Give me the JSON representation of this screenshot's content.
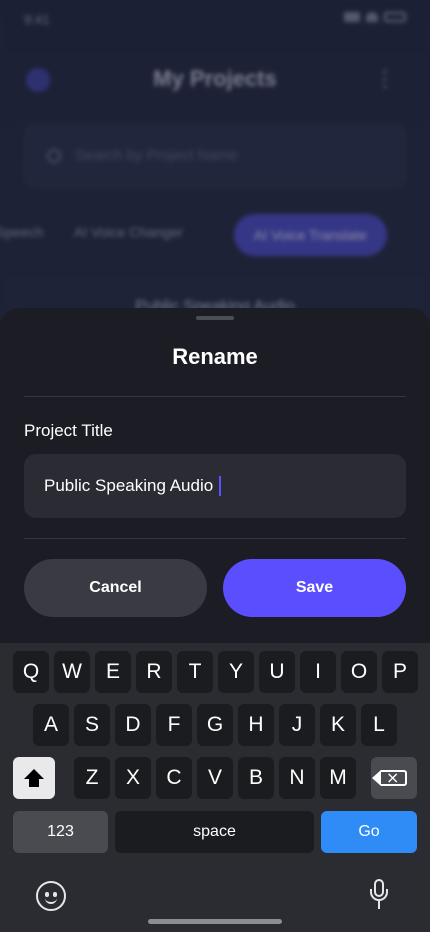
{
  "status_bar": {
    "time": "9:41"
  },
  "background": {
    "title": "My Projects",
    "search_placeholder": "Search by Project Name",
    "tabs": [
      "Speech",
      "AI Voice Changer",
      "AI Voice Translate"
    ],
    "list_item": "Public Speaking Audio"
  },
  "sheet": {
    "title": "Rename",
    "field_label": "Project Title",
    "field_value": "Public Speaking Audio",
    "cancel_label": "Cancel",
    "save_label": "Save"
  },
  "keyboard": {
    "row1": [
      "Q",
      "W",
      "E",
      "R",
      "T",
      "Y",
      "U",
      "I",
      "O",
      "P"
    ],
    "row2": [
      "A",
      "S",
      "D",
      "F",
      "G",
      "H",
      "J",
      "K",
      "L"
    ],
    "row3": [
      "Z",
      "X",
      "C",
      "V",
      "B",
      "N",
      "M"
    ],
    "numbers_label": "123",
    "space_label": "space",
    "go_label": "Go"
  },
  "colors": {
    "accent": "#5a4eff",
    "go_key": "#2f8cf7",
    "sheet_bg": "#1c1d24"
  }
}
